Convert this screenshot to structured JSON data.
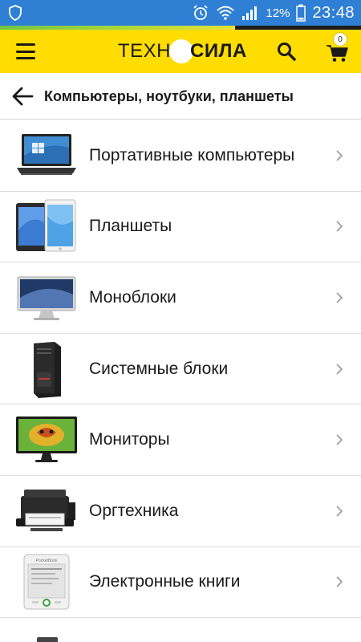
{
  "status_bar": {
    "battery_percent": "12%",
    "time": "23:48",
    "icons": [
      "shield-icon",
      "alarm-icon",
      "wifi-icon",
      "signal-icon",
      "battery-icon"
    ]
  },
  "progress": {
    "fraction": 0.65
  },
  "header": {
    "logo_part1": "ТЕХН",
    "logo_part2": "СИЛА",
    "cart_count": "0",
    "brand_color": "#ffdd00"
  },
  "subheader": {
    "title": "Компьютеры, ноутбуки, планшеты"
  },
  "categories": [
    {
      "label": "Портативные компьютеры",
      "thumb": "laptop"
    },
    {
      "label": "Планшеты",
      "thumb": "tablets"
    },
    {
      "label": "Моноблоки",
      "thumb": "all-in-one"
    },
    {
      "label": "Системные блоки",
      "thumb": "pc-tower"
    },
    {
      "label": "Мониторы",
      "thumb": "monitor"
    },
    {
      "label": "Оргтехника",
      "thumb": "printer"
    },
    {
      "label": "Электронные книги",
      "thumb": "ebook",
      "thumb_text": "PocketBook"
    }
  ]
}
